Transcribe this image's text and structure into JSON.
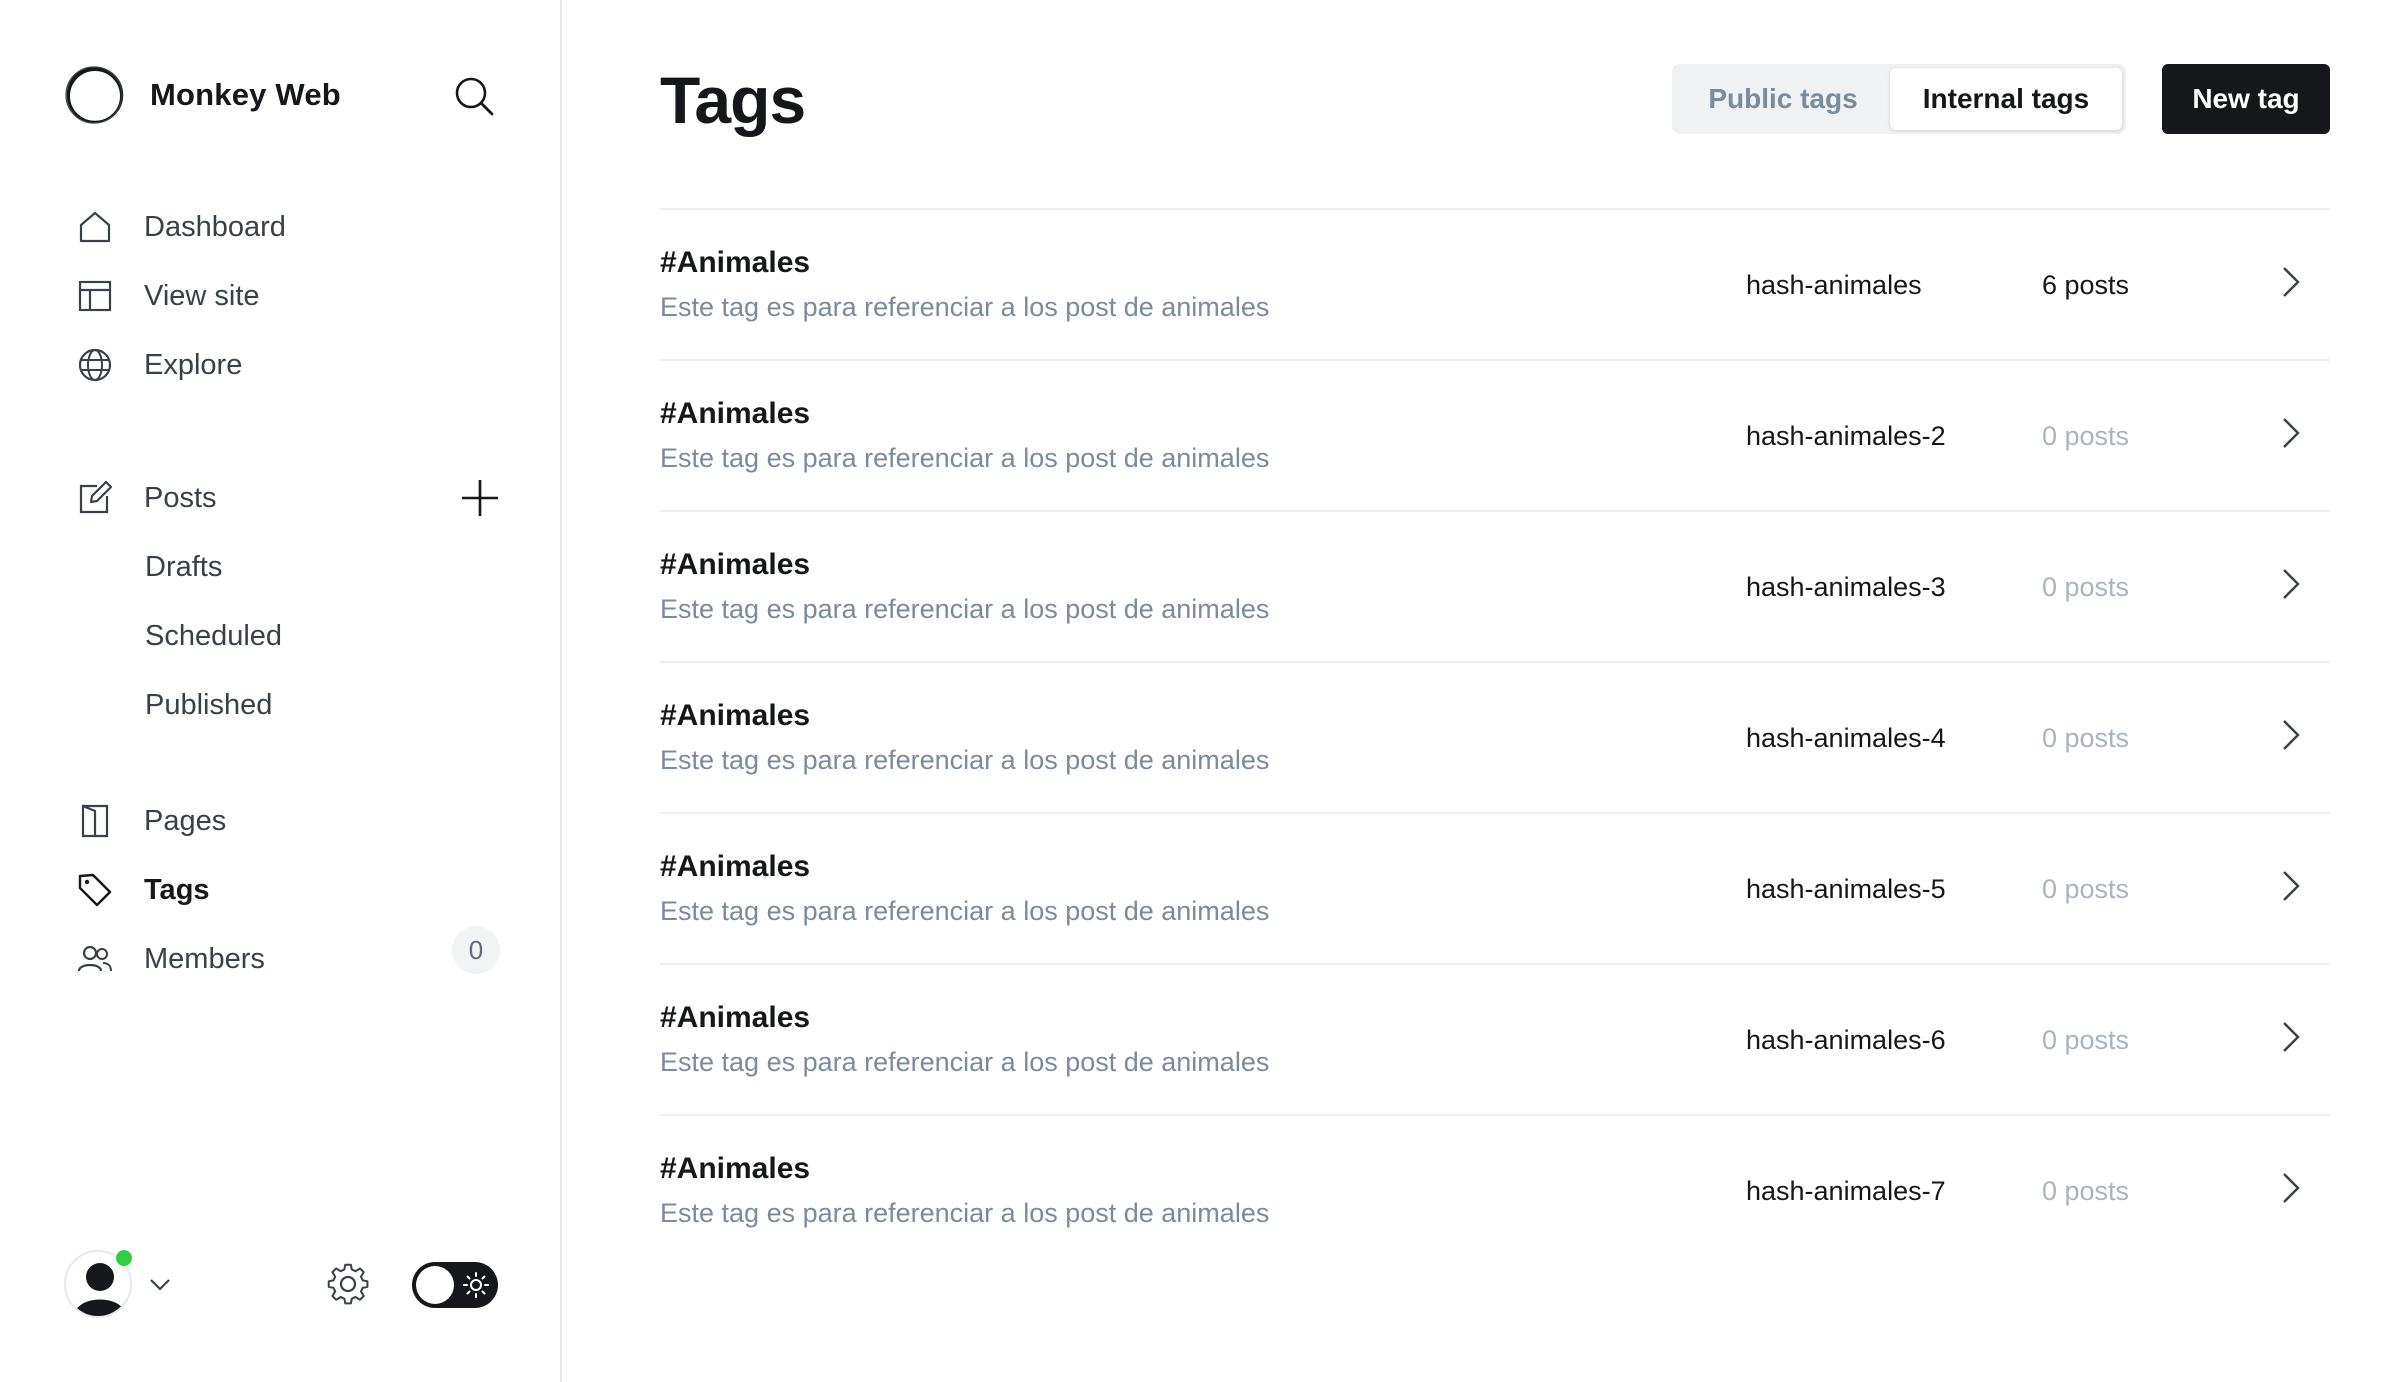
{
  "sidebar": {
    "brand_name": "Monkey Web",
    "nav": {
      "dashboard": "Dashboard",
      "view_site": "View site",
      "explore": "Explore",
      "posts": "Posts",
      "drafts": "Drafts",
      "scheduled": "Scheduled",
      "published": "Published",
      "pages": "Pages",
      "tags": "Tags",
      "members": "Members",
      "members_count": "0"
    },
    "active_item": "Tags",
    "icons": [
      "search-icon",
      "home-icon",
      "layout-icon",
      "globe-icon",
      "edit-icon",
      "plus-icon",
      "page-icon",
      "tag-icon",
      "members-icon",
      "user-icon",
      "chevron-down-icon",
      "gear-icon",
      "sun-icon"
    ]
  },
  "header": {
    "title": "Tags",
    "tabs": {
      "public": "Public tags",
      "internal": "Internal tags"
    },
    "active_tab": "Internal tags",
    "new_tag_label": "New tag"
  },
  "tags": [
    {
      "name": "#Animales",
      "description": "Este tag es para referenciar a los post de animales",
      "slug": "hash-animales",
      "count": "6 posts"
    },
    {
      "name": "#Animales",
      "description": "Este tag es para referenciar a los post de animales",
      "slug": "hash-animales-2",
      "count": "0 posts"
    },
    {
      "name": "#Animales",
      "description": "Este tag es para referenciar a los post de animales",
      "slug": "hash-animales-3",
      "count": "0 posts"
    },
    {
      "name": "#Animales",
      "description": "Este tag es para referenciar a los post de animales",
      "slug": "hash-animales-4",
      "count": "0 posts"
    },
    {
      "name": "#Animales",
      "description": "Este tag es para referenciar a los post de animales",
      "slug": "hash-animales-5",
      "count": "0 posts"
    },
    {
      "name": "#Animales",
      "description": "Este tag es para referenciar a los post de animales",
      "slug": "hash-animales-6",
      "count": "0 posts"
    },
    {
      "name": "#Animales",
      "description": "Este tag es para referenciar a los post de animales",
      "slug": "hash-animales-7",
      "count": "0 posts"
    }
  ],
  "colors": {
    "accent_dark": "#15171a",
    "muted_text": "#7c8b9a",
    "online_dot": "#30cf43"
  }
}
